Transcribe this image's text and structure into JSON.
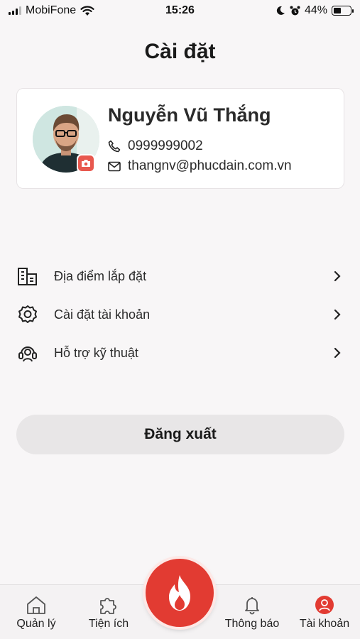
{
  "status_bar": {
    "carrier": "MobiFone",
    "time": "15:26",
    "battery": "44%",
    "battery_level": 0.44
  },
  "header": {
    "title": "Cài đặt"
  },
  "profile": {
    "name": "Nguyễn Vũ Thắng",
    "phone": "0999999002",
    "email": "thangnv@phucdain.com.vn",
    "avatar_icon": "avatar-photo",
    "camera_icon": "camera-icon"
  },
  "menu": {
    "items": [
      {
        "label": "Địa điểm lắp đặt",
        "icon": "building-icon"
      },
      {
        "label": "Cài đặt tài khoản",
        "icon": "gear-icon"
      },
      {
        "label": "Hỗ trợ kỹ thuật",
        "icon": "support-icon"
      }
    ]
  },
  "logout": {
    "label": "Đăng xuất"
  },
  "tabs": {
    "items": [
      {
        "label": "Quản lý",
        "icon": "home-icon",
        "active": false
      },
      {
        "label": "Tiện ích",
        "icon": "puzzle-icon",
        "active": false
      },
      {
        "label": "Thông báo",
        "icon": "bell-icon",
        "active": false
      },
      {
        "label": "Tài khoản",
        "icon": "user-icon",
        "active": true
      }
    ],
    "center_icon": "flame-icon"
  },
  "colors": {
    "accent": "#e23b32",
    "background": "#f8f6f7",
    "card": "#ffffff",
    "logout_bg": "#e8e6e7"
  }
}
